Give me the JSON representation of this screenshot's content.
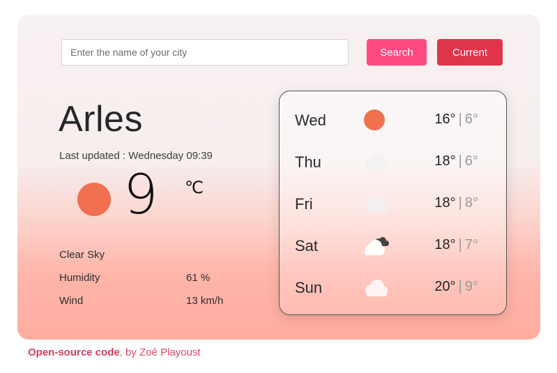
{
  "search": {
    "placeholder": "Enter the name of your city",
    "search_label": "Search",
    "current_label": "Current"
  },
  "current": {
    "city": "Arles",
    "updated": "Last updated : Wednesday 09:39",
    "temperature": "9",
    "unit": "℃",
    "icon": "sun-icon",
    "description": "Clear Sky",
    "humidity_label": "Humidity",
    "humidity_value": "61 %",
    "wind_label": "Wind",
    "wind_value": "13 km/h"
  },
  "forecast": [
    {
      "day": "Wed",
      "icon": "sun-icon",
      "high": "16°",
      "low": "6°"
    },
    {
      "day": "Thu",
      "icon": "cloud-icon",
      "high": "18°",
      "low": "6°"
    },
    {
      "day": "Fri",
      "icon": "cloud-icon",
      "high": "18°",
      "low": "8°"
    },
    {
      "day": "Sat",
      "icon": "broken-clouds-icon",
      "high": "18°",
      "low": "7°"
    },
    {
      "day": "Sun",
      "icon": "cloud-icon",
      "high": "20°",
      "low": "9°"
    }
  ],
  "footer": {
    "link_text": "Open-source code",
    "suffix": ", by Zoé Playoust"
  },
  "colors": {
    "search_button": "#ff4a7f",
    "current_button": "#e0344a",
    "sun": "#f07050"
  }
}
